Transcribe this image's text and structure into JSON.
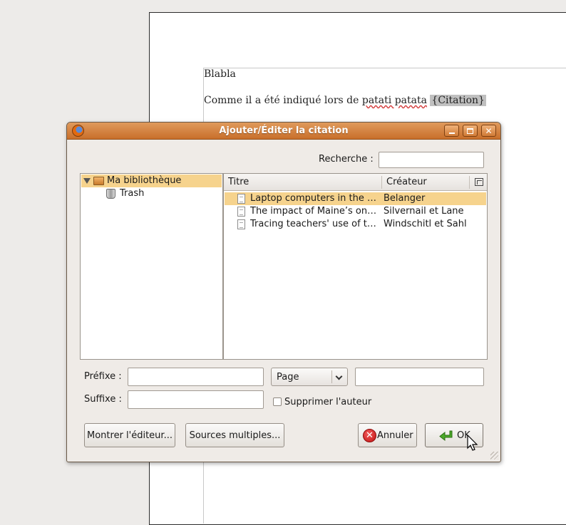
{
  "document": {
    "line1": "Blabla",
    "line2_prefix": "Comme il a été indiqué lors de ",
    "line2_wavy": "patati patata",
    "line2_field": "{Citation}"
  },
  "dialog": {
    "title": "Ajouter/Éditer la citation",
    "search": {
      "label": "Recherche :",
      "value": ""
    },
    "tree": [
      {
        "label": "Ma bibliothèque",
        "icon": "library-icon",
        "selected": true,
        "expanded": true
      },
      {
        "label": "Trash",
        "icon": "trash-icon",
        "selected": false
      }
    ],
    "items": {
      "columns": [
        "Titre",
        "Créateur"
      ],
      "rows": [
        {
          "title": "Laptop computers in the K...",
          "creator": "Belanger",
          "selected": true
        },
        {
          "title": "The impact of Maine’s one...",
          "creator": "Silvernail et Lane",
          "selected": false
        },
        {
          "title": "Tracing teachers' use of te...",
          "creator": "Windschitl et Sahl",
          "selected": false
        }
      ]
    },
    "form": {
      "prefix_label": "Préfixe :",
      "suffix_label": "Suffixe :",
      "prefix_value": "",
      "suffix_value": "",
      "locator_type": "Page",
      "locator_value": "",
      "suppress_author_label": "Supprimer l'auteur",
      "suppress_author_checked": false
    },
    "buttons": {
      "show_editor": "Montrer l'éditeur...",
      "multiple_sources": "Sources multiples...",
      "cancel": "Annuler",
      "ok": "OK"
    }
  },
  "colors": {
    "titlebar": "#d37f3c",
    "selection": "#f6d38d",
    "dialog_bg": "#efebe7",
    "desktop_bg": "#edebe9"
  }
}
